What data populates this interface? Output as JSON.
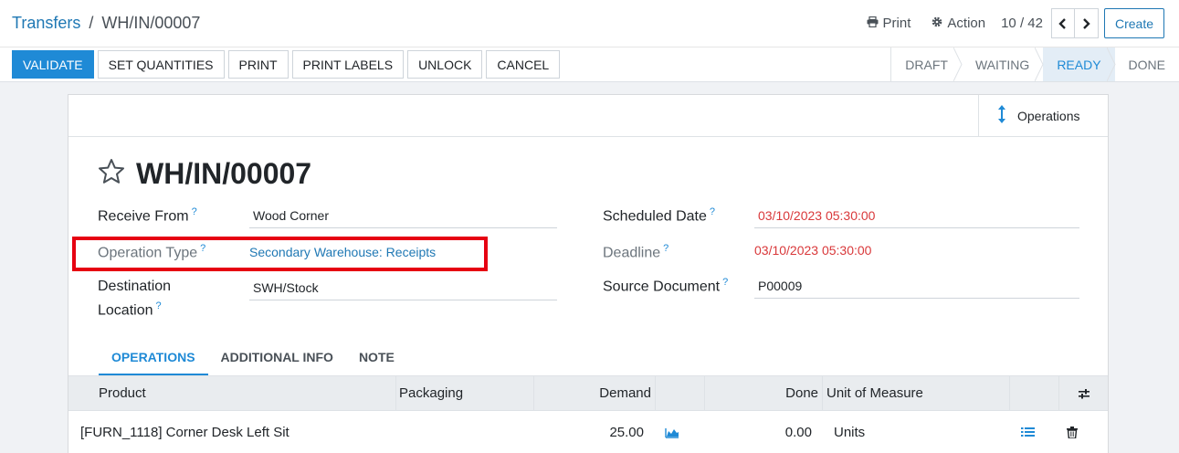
{
  "breadcrumb": {
    "parent": "Transfers",
    "separator": "/",
    "current": "WH/IN/00007"
  },
  "top_actions": {
    "print": "Print",
    "action": "Action",
    "pager": "10 / 42",
    "prev": "‹",
    "next": "›",
    "create": "Create"
  },
  "buttons": [
    "VALIDATE",
    "SET QUANTITIES",
    "PRINT",
    "PRINT LABELS",
    "UNLOCK",
    "CANCEL"
  ],
  "stages": [
    {
      "label": "DRAFT",
      "active": false
    },
    {
      "label": "WAITING",
      "active": false
    },
    {
      "label": "READY",
      "active": true
    },
    {
      "label": "DONE",
      "active": false
    }
  ],
  "smart_button": {
    "label": "Operations",
    "icon": "arrows-v-icon"
  },
  "record": {
    "title": "WH/IN/00007"
  },
  "fields": {
    "receive_from": {
      "label": "Receive From",
      "help": "?",
      "value": "Wood Corner"
    },
    "operation_type": {
      "label": "Operation Type",
      "help": "?",
      "value": "Secondary Warehouse: Receipts"
    },
    "destination": {
      "label_line1": "Destination",
      "label_line2": "Location",
      "help": "?",
      "value": "SWH/Stock"
    },
    "scheduled_date": {
      "label": "Scheduled Date",
      "help": "?",
      "value": "03/10/2023 05:30:00"
    },
    "deadline": {
      "label": "Deadline",
      "help": "?",
      "value": "03/10/2023 05:30:00"
    },
    "source_document": {
      "label": "Source Document",
      "help": "?",
      "value": "P00009"
    }
  },
  "tabs": [
    {
      "label": "OPERATIONS",
      "active": true
    },
    {
      "label": "ADDITIONAL INFO",
      "active": false
    },
    {
      "label": "NOTE",
      "active": false
    }
  ],
  "table": {
    "headers": {
      "product": "Product",
      "packaging": "Packaging",
      "demand": "Demand",
      "done": "Done",
      "uom": "Unit of Measure"
    },
    "rows": [
      {
        "product": "[FURN_1118] Corner Desk Left Sit",
        "packaging": "",
        "demand": "25.00",
        "done": "0.00",
        "uom": "Units"
      }
    ]
  },
  "colors": {
    "primary": "#1f8ad6",
    "link": "#1f78b4",
    "danger": "#d9383a",
    "highlight": "#e60012"
  }
}
